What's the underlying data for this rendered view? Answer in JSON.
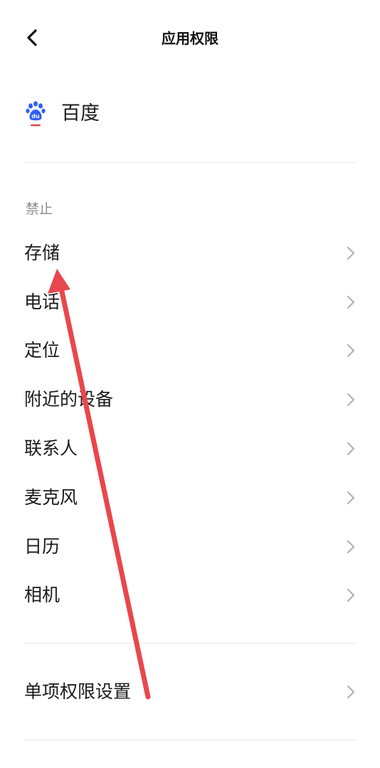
{
  "header": {
    "title": "应用权限"
  },
  "app": {
    "name": "百度"
  },
  "section": {
    "label": "禁止"
  },
  "permissions": [
    "存储",
    "电话",
    "定位",
    "附近的设备",
    "联系人",
    "麦克风",
    "日历",
    "相机"
  ],
  "single_setting": {
    "label": "单项权限设置"
  },
  "colors": {
    "annotation_arrow": "#e8474d",
    "baidu_blue": "#2d5ff5",
    "baidu_red": "#e03a3e",
    "divider": "#e9e9e9",
    "section_label": "#8c8c8c"
  },
  "icons": {
    "back": "chevron-left-icon",
    "row": "chevron-right-icon",
    "app": "baidu-logo-icon"
  }
}
